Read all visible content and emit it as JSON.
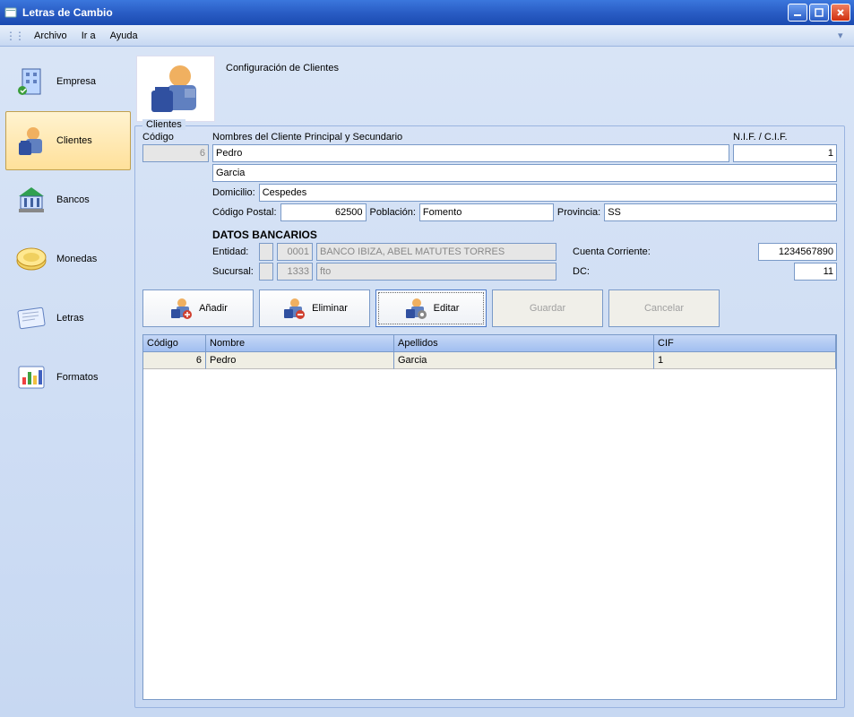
{
  "window": {
    "title": "Letras de Cambio"
  },
  "menu": {
    "archivo": "Archivo",
    "ir_a": "Ir a",
    "ayuda": "Ayuda"
  },
  "sidebar": {
    "items": [
      {
        "label": "Empresa"
      },
      {
        "label": "Clientes"
      },
      {
        "label": "Bancos"
      },
      {
        "label": "Monedas"
      },
      {
        "label": "Letras"
      },
      {
        "label": "Formatos"
      }
    ]
  },
  "content": {
    "header_title": "Configuración de Clientes",
    "fieldset_legend": "Clientes",
    "labels": {
      "codigo": "Código",
      "nombres": "Nombres del Cliente Principal y Secundario",
      "nif": "N.I.F. / C.I.F.",
      "domicilio": "Domicilio:",
      "cp": "Código Postal:",
      "poblacion": "Población:",
      "provincia": "Provincia:",
      "datos_bancarios": "DATOS BANCARIOS",
      "entidad": "Entidad:",
      "sucursal": "Sucursal:",
      "cuenta": "Cuenta Corriente:",
      "dc": "DC:"
    },
    "values": {
      "codigo": "6",
      "nombre_principal": "Pedro",
      "nif": "1",
      "nombre_secundario": "Garcia",
      "domicilio": "Cespedes",
      "cp": "62500",
      "poblacion": "Fomento",
      "provincia": "SS",
      "entidad_code": "0001",
      "entidad_name": "BANCO IBIZA, ABEL MATUTES TORRES",
      "sucursal_code": "1333",
      "sucursal_name": "fto",
      "cuenta": "1234567890",
      "dc": "11"
    },
    "actions": {
      "anadir": "Añadir",
      "eliminar": "Eliminar",
      "editar": "Editar",
      "guardar": "Guardar",
      "cancelar": "Cancelar"
    },
    "table": {
      "headers": {
        "codigo": "Código",
        "nombre": "Nombre",
        "apellidos": "Apellidos",
        "cif": "CIF"
      },
      "rows": [
        {
          "codigo": "6",
          "nombre": "Pedro",
          "apellidos": "Garcia",
          "cif": "1"
        }
      ]
    }
  }
}
